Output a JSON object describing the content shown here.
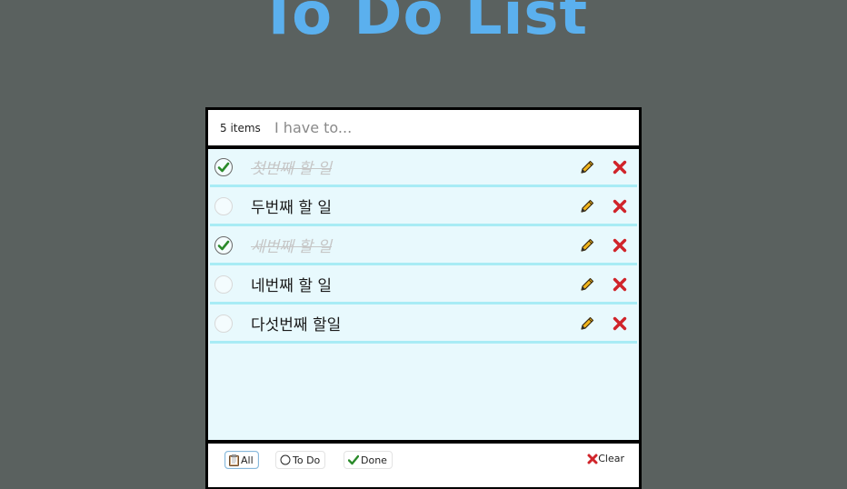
{
  "page": {
    "title": "To Do List"
  },
  "header": {
    "count_text": "5 items",
    "input_placeholder": "I have to...",
    "input_value": ""
  },
  "todos": [
    {
      "text": "첫번째 할 일",
      "done": true
    },
    {
      "text": "두번째 할 일",
      "done": false
    },
    {
      "text": "세번째 할 일",
      "done": true
    },
    {
      "text": "네번째 할 일",
      "done": false
    },
    {
      "text": "다섯번째 할일",
      "done": false
    }
  ],
  "footer": {
    "all_label": "All",
    "todo_label": "To Do",
    "done_label": "Done",
    "clear_label": "Clear",
    "active_filter": "All"
  },
  "colors": {
    "background": "#5a615f",
    "title": "#5bb0ee",
    "list_bg": "#e8f9fd",
    "item_border": "#a8ecf5",
    "check_green": "#2a8a2a",
    "delete_red": "#d0242a",
    "pencil_yellow": "#f2b51c"
  },
  "icons": {
    "check": "check-icon",
    "edit": "pencil-icon",
    "delete": "x-icon",
    "all": "clipboard-icon",
    "todo": "circle-icon",
    "done": "check-icon",
    "clear": "x-icon"
  }
}
